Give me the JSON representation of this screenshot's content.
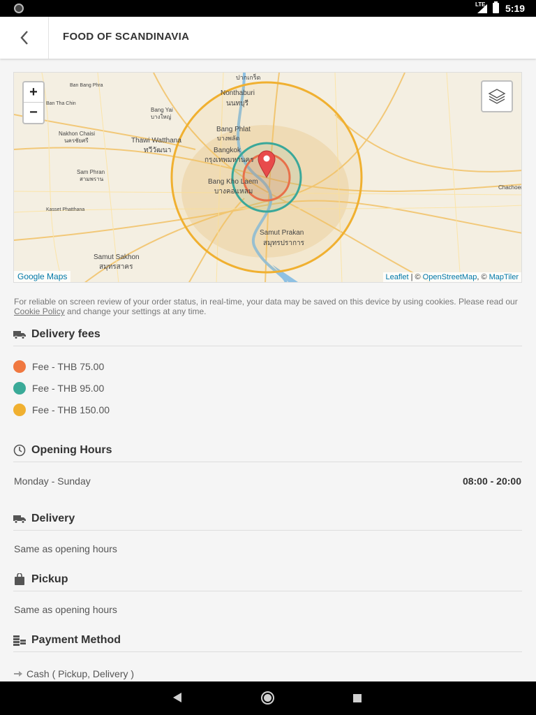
{
  "status_bar": {
    "network": "LTE",
    "time": "5:19"
  },
  "header": {
    "title": "FOOD OF SCANDINAVIA",
    "back_icon": "chevron-left-icon"
  },
  "map": {
    "zoom_in": "+",
    "zoom_out": "−",
    "google_maps_link": "Google Maps",
    "attribution": {
      "leaflet": "Leaflet",
      "sep1": " | © ",
      "osm": "OpenStreetMap",
      "sep2": ", © ",
      "maptiler": "MapTiler"
    },
    "place_labels": [
      "ปากเกร็ด",
      "Nonthaburi",
      "นนทบุรี",
      "Bang Phlat",
      "บางพลัด",
      "Bangkok",
      "กรุงเทพมหานคร",
      "Thawi Watthana",
      "ทวีวัฒนา",
      "Bang Kho Laem",
      "บางคอแหลม",
      "Samut Prakan",
      "สมุทรปราการ",
      "Samut Sakhon",
      "สมุทรสาคร",
      "Nakhon Chaisi",
      "นครชัยศรี",
      "Sam Phran",
      "สามพราน",
      "Bang Yai",
      "บางใหญ่",
      "Chachoeng",
      "Ban Bang Phra",
      "Kaset Phatthana",
      "Ban Tha Chin"
    ],
    "zone_colors": {
      "inner": "#e8704a",
      "middle": "#3aa89a",
      "outer": "#f0b030"
    },
    "marker_color": "#e84b4b"
  },
  "cookie_notice": {
    "text_before": "For reliable on screen review of your order status, in real-time, your data may be saved on this device by using cookies. Please read our ",
    "link": "Cookie Policy",
    "text_after": " and change your settings at any time."
  },
  "delivery_fees": {
    "title": "Delivery fees",
    "icon": "truck-icon",
    "items": [
      {
        "label": "Fee - THB 75.00",
        "color": "#f07840"
      },
      {
        "label": "Fee - THB 95.00",
        "color": "#3aaa98"
      },
      {
        "label": "Fee - THB 150.00",
        "color": "#f0b030"
      }
    ]
  },
  "opening_hours": {
    "title": "Opening Hours",
    "icon": "clock-icon",
    "days": "Monday - Sunday",
    "time": "08:00 - 20:00"
  },
  "delivery": {
    "title": "Delivery",
    "icon": "truck-icon",
    "text": "Same as opening hours"
  },
  "pickup": {
    "title": "Pickup",
    "icon": "shopping-bag-icon",
    "text": "Same as opening hours"
  },
  "payment": {
    "title": "Payment Method",
    "icon": "coins-icon",
    "methods": [
      "Cash ( Pickup, Delivery )"
    ]
  }
}
